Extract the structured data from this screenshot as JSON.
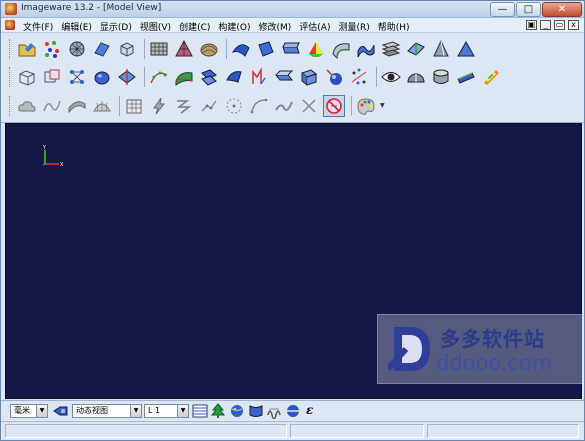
{
  "window": {
    "title": "Imageware 13.2 - [Model View]",
    "minimize_glyph": "—",
    "maximize_glyph": "□",
    "close_glyph": "✕"
  },
  "menu": {
    "items": [
      "文件(F)",
      "编辑(E)",
      "显示(D)",
      "视图(V)",
      "创建(C)",
      "构建(O)",
      "修改(M)",
      "评估(A)",
      "测量(R)",
      "帮助(H)"
    ],
    "mdi_buttons": [
      "▣",
      "_",
      "▭",
      "x"
    ]
  },
  "toolbar": {
    "row1": [
      "open-folder-icon",
      "point-cloud-icon",
      "mesh-sphere-icon",
      "plane-surface-icon",
      "cube-icon",
      "scan-grid-icon",
      "pyramid-mesh-icon",
      "shell-mesh-icon",
      "blue-surface-icon",
      "surface-patch-icon",
      "loft-surface-icon",
      "tri-color-blend-icon",
      "curved-surface-icon",
      "wave-surface-icon",
      "stacked-surfaces-icon",
      "flat-fold-icon",
      "cone-surface-icon",
      "triangle-surface-icon"
    ],
    "row2": [
      "wire-box-icon",
      "transform-box-icon",
      "node-graph-icon",
      "sphere-blob-icon",
      "plane-intersect-icon",
      "curve-points-icon",
      "green-patch-icon",
      "fillet-surface-icon",
      "offset-surface-icon",
      "extrude-arrow-icon",
      "trim-surface-icon",
      "grid-panel-icon",
      "sphere-probe-icon",
      "scatter-points-icon",
      "eye-view-icon",
      "half-disc-icon",
      "cylinder-icon",
      "flat-bar-icon",
      "color-map-icon"
    ],
    "row3": [
      "cloud-gray-icon",
      "curve-gray-icon",
      "twist-gray-icon",
      "fan-gray-icon",
      "table-grid-icon",
      "lightning-icon",
      "zigzag-icon",
      "connect-nodes-icon",
      "dashed-circle-icon",
      "arc-curve-icon",
      "bend-curve-icon",
      "cross-icon",
      "no-entry-icon",
      "palette-icon"
    ]
  },
  "viewport": {
    "axis_y": "Y",
    "axis_x": "X",
    "watermark_cn": "多多软件站",
    "watermark_en": "ddooo.com"
  },
  "bottom": {
    "unit": "毫米",
    "view_mode": "动态视图",
    "layer": "L 1",
    "epsilon": "ε"
  }
}
